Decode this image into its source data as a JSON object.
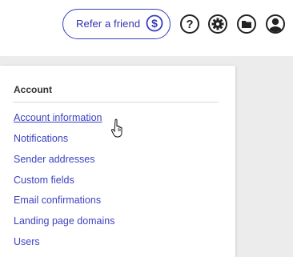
{
  "header": {
    "refer_button_label": "Refer a friend",
    "icons": [
      "dollar-icon",
      "help-icon",
      "gear-icon",
      "folder-icon",
      "user-icon"
    ],
    "accent_color": "#3a3dbd"
  },
  "dropdown": {
    "heading": "Account",
    "items": [
      {
        "label": "Account information",
        "active": true
      },
      {
        "label": "Notifications"
      },
      {
        "label": "Sender addresses"
      },
      {
        "label": "Custom fields"
      },
      {
        "label": "Email confirmations"
      },
      {
        "label": "Landing page domains"
      },
      {
        "label": "Users"
      }
    ],
    "link_color": "#3c42c0"
  }
}
